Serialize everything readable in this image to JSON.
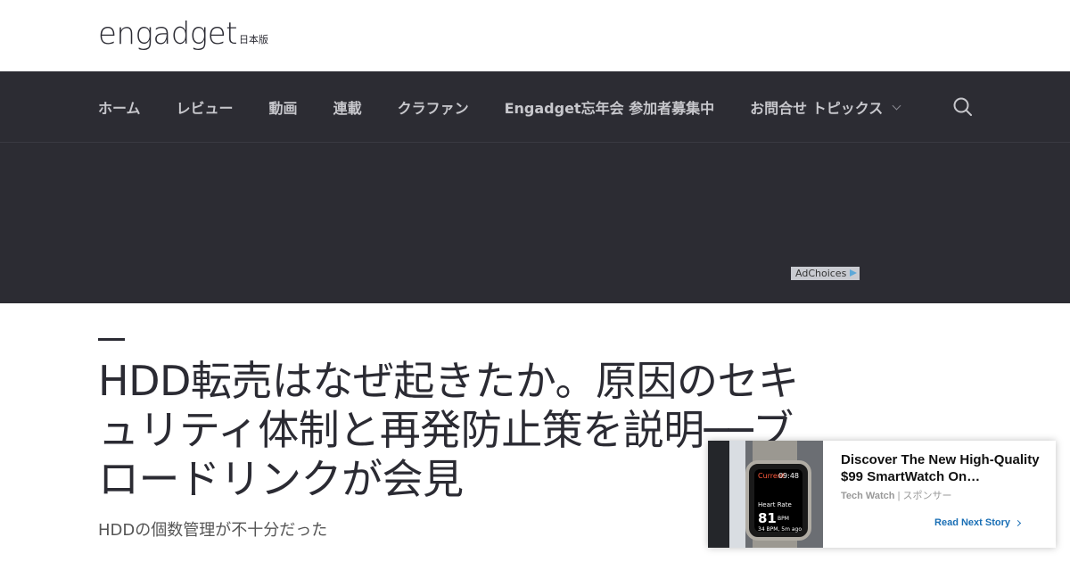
{
  "header": {
    "logo_text": "engadget",
    "logo_sub": "日本版"
  },
  "nav": {
    "items": [
      {
        "label": "ホーム"
      },
      {
        "label": "レビュー"
      },
      {
        "label": "動画"
      },
      {
        "label": "連載"
      },
      {
        "label": "クラファン"
      },
      {
        "label": "Engadget忘年会 参加者募集中"
      },
      {
        "label": "お問合せ トピックス"
      }
    ],
    "search_icon": "search-icon"
  },
  "ad": {
    "adchoices_label": "AdChoices"
  },
  "article": {
    "headline": "HDD転売はなぜ起きたか。原因のセキュリティ体制と再発防止策を説明──ブロードリンクが会見",
    "subheadline": "HDDの個数管理が不十分だった"
  },
  "recommendation": {
    "title": "Discover The New High-Quality $99 SmartWatch On…",
    "source": "Tech Watch",
    "sponsor_label": "スポンサー",
    "cta": "Read Next Story",
    "watch_screen": {
      "top_label": "Current",
      "time": "09:48",
      "metric_label": "Heart Rate",
      "metric_value": "81",
      "metric_unit": "BPM",
      "metric_sub": "34 BPM, 5m ago"
    }
  },
  "colors": {
    "nav_bg": "#2c2c33",
    "nav_text": "#c7c7cc",
    "cta_blue": "#1a6fb5"
  }
}
